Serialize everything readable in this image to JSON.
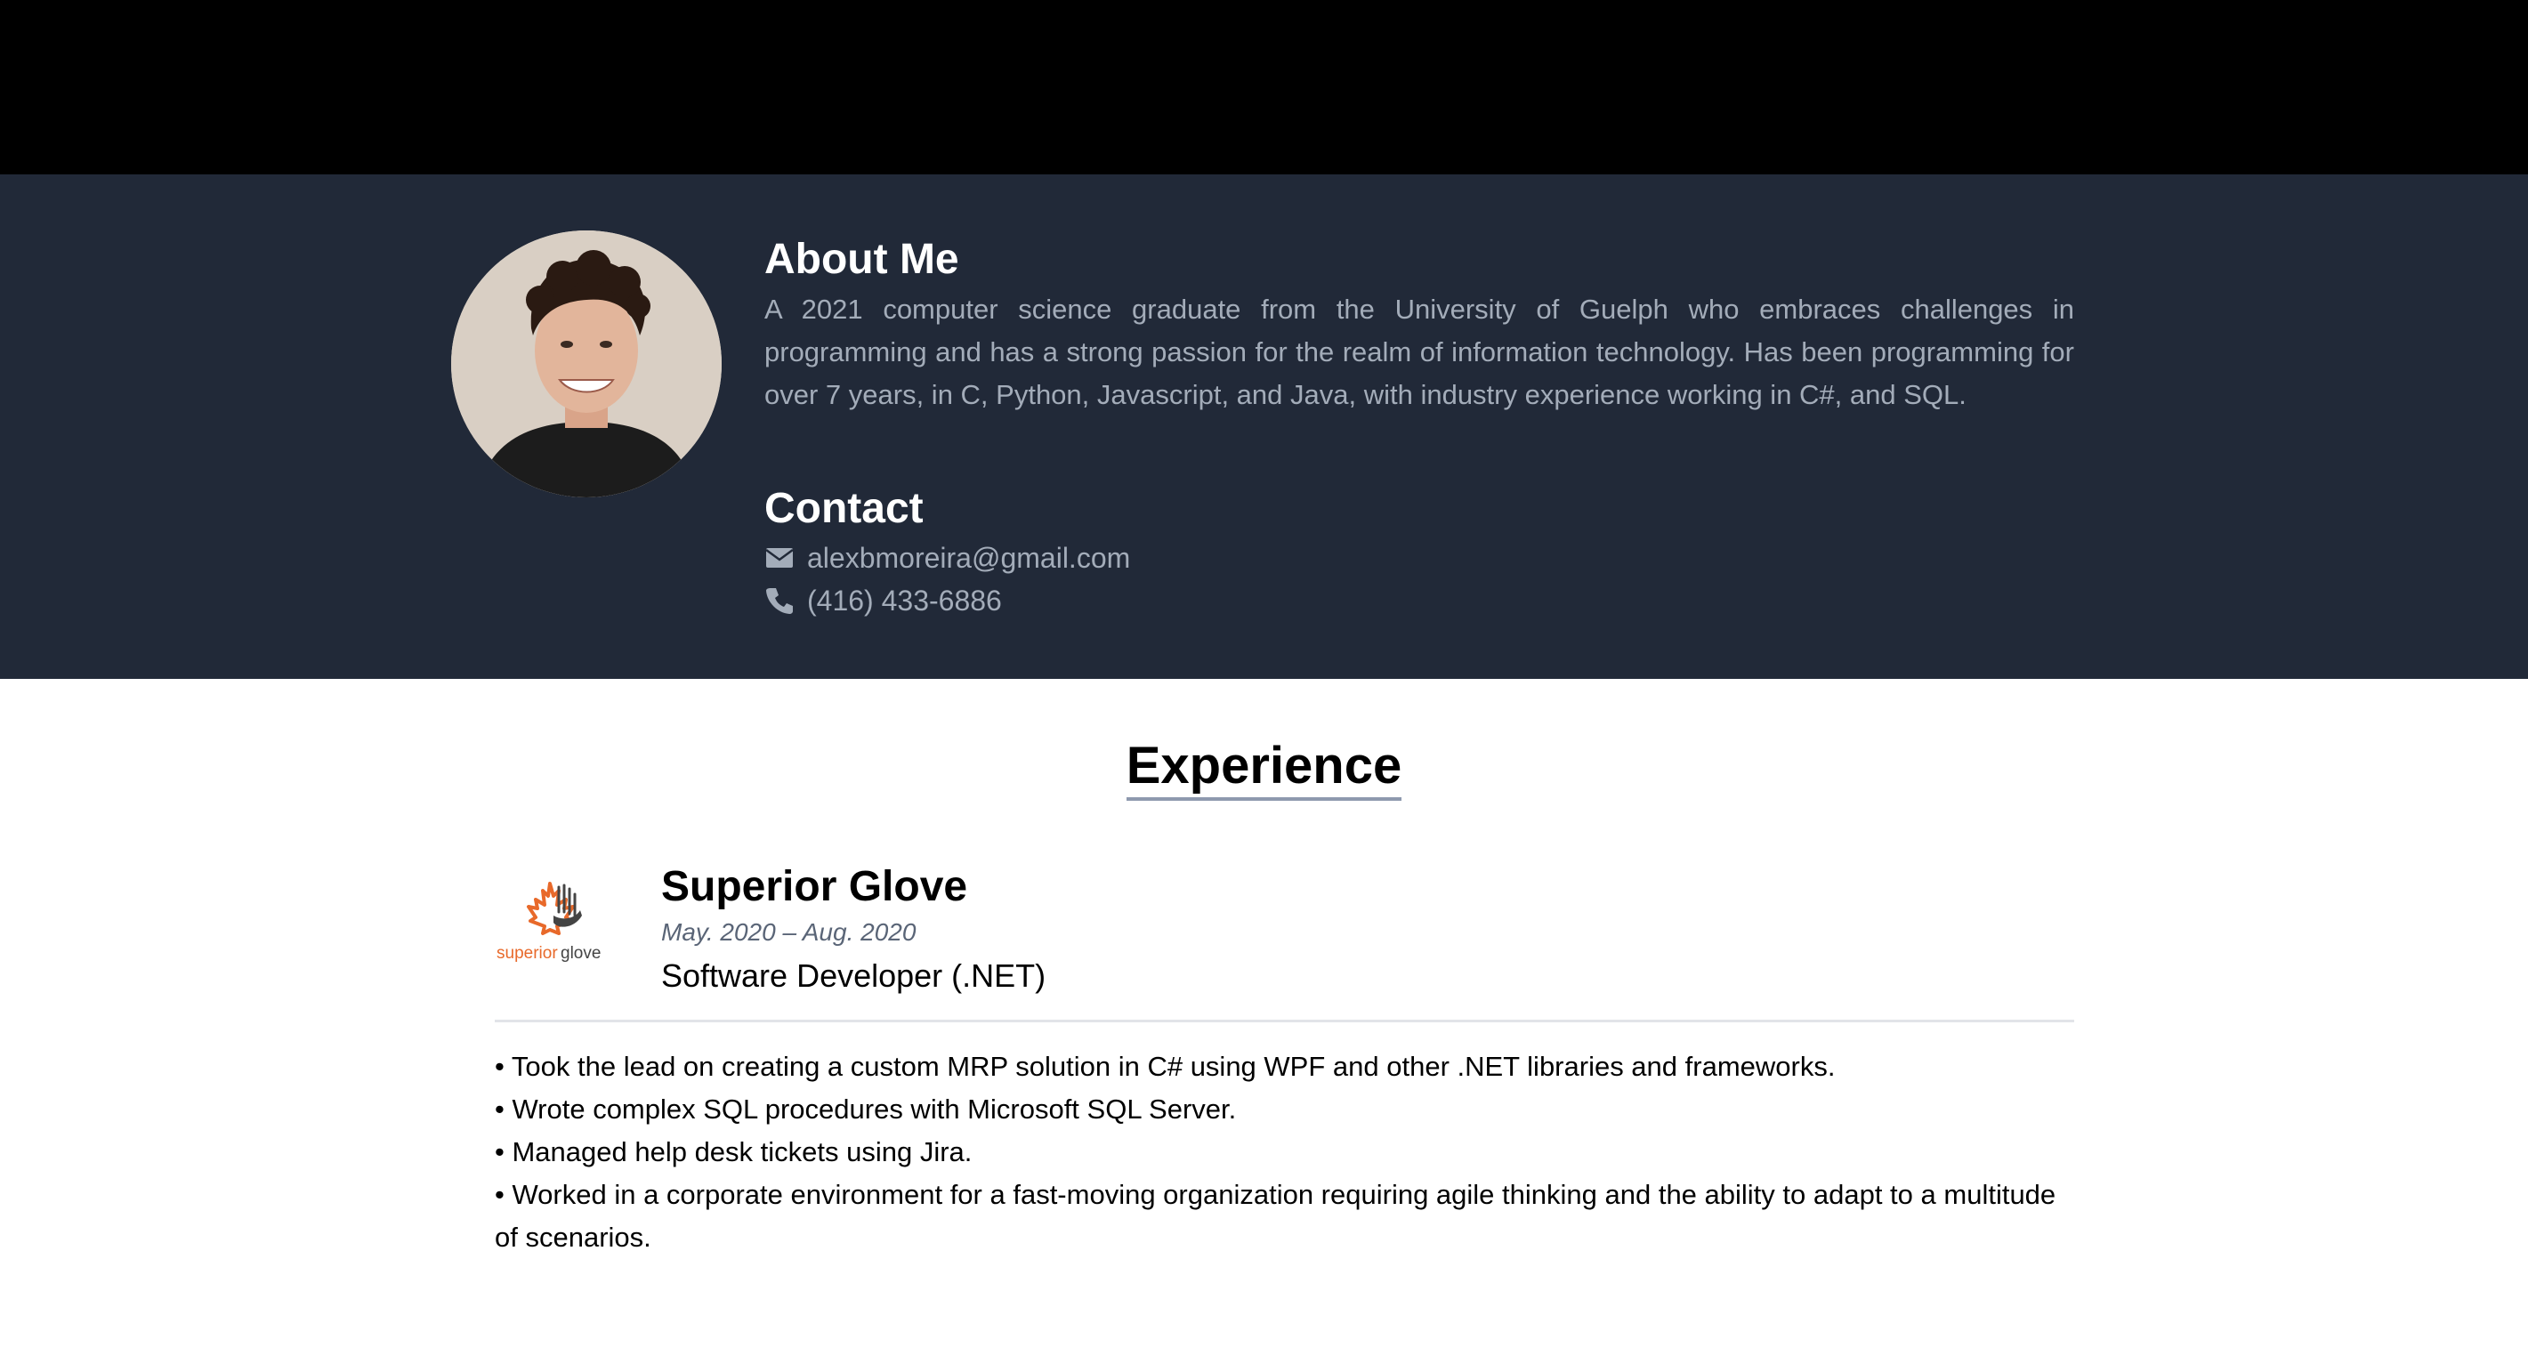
{
  "about": {
    "title": "About Me",
    "text": "A 2021 computer science graduate from the University of Guelph who embraces challenges in programming and has a strong passion for the realm of information technology. Has been programming for over 7 years, in C, Python, Javascript, and Java, with industry experience working in C#, and SQL."
  },
  "contact": {
    "title": "Contact",
    "email": "alexbmoreira@gmail.com",
    "phone": "(416) 433-6886",
    "email_icon": "envelope-icon",
    "phone_icon": "phone-icon"
  },
  "experience": {
    "title": "Experience",
    "jobs": [
      {
        "company": "Superior Glove",
        "logo_text_a": "superior",
        "logo_text_b": "glove",
        "dates": "May. 2020 – Aug. 2020",
        "role": "Software Developer (.NET)",
        "bullets": [
          "• Took the lead on creating a custom MRP solution in C# using WPF and other .NET libraries and frameworks.",
          "• Wrote complex SQL procedures with Microsoft SQL Server.",
          "• Managed help desk tickets using Jira.",
          "• Worked in a corporate environment for a fast-moving organization requiring agile thinking and the ability to adapt to a multitude of scenarios."
        ]
      }
    ]
  },
  "colors": {
    "topbar": "#000000",
    "hero": "#212938",
    "muted_text": "#a3acb9",
    "accent_orange": "#e8692a"
  }
}
